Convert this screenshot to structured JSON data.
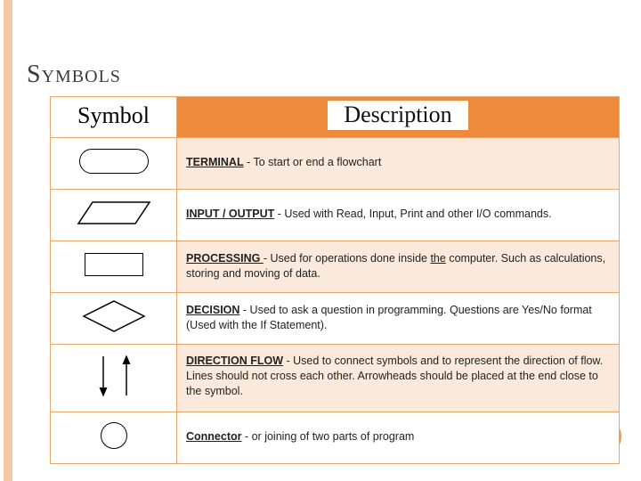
{
  "title_html": "Symbols",
  "headers": {
    "symbol": "Symbol",
    "description": "Description"
  },
  "rows": [
    {
      "icon": "terminal",
      "term": "TERMINAL",
      "sep": " - ",
      "desc": "To start or end a flowchart"
    },
    {
      "icon": "io",
      "term": "INPUT / OUTPUT",
      "sep": " - ",
      "desc": "Used with Read, Input, Print and other I/O commands."
    },
    {
      "icon": "process",
      "term": "PROCESSING ",
      "sep": "- ",
      "desc_pre": "Used for operations done inside ",
      "desc_u": "the",
      "desc_post": " computer. Such as calculations, storing and moving of data."
    },
    {
      "icon": "decision",
      "term": "DECISION",
      "sep": " - ",
      "desc": "Used to ask a question in programming. Questions are Yes/No format (Used with the If Statement)."
    },
    {
      "icon": "flow",
      "term": "DIRECTION FLOW",
      "sep": " - ",
      "desc": "Used to connect symbols and to represent the direction of flow. Lines should not cross each other. Arrowheads should be placed at the end close to the symbol."
    },
    {
      "icon": "connector",
      "term": "Connector",
      "sep": " - ",
      "desc": "or joining of two parts of program"
    }
  ]
}
